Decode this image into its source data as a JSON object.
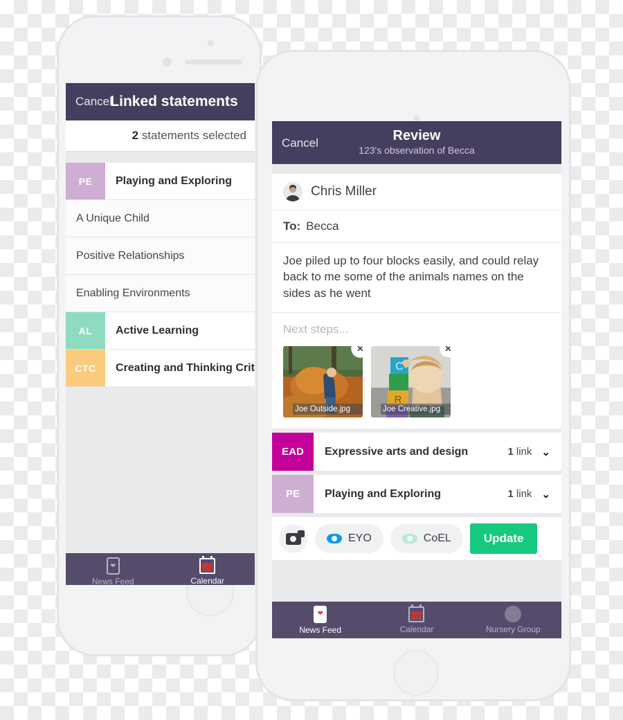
{
  "left_phone": {
    "navbar": {
      "cancel_label": "Cancel",
      "title": "Linked statements"
    },
    "selection_bar": {
      "count": "2",
      "text": " statements selected"
    },
    "statement_groups": [
      {
        "code": "PE",
        "label": "Playing and Exploring",
        "color": "#ceaed2",
        "bold": true
      },
      {
        "code": "",
        "label": "A Unique Child",
        "color": "",
        "bold": false
      },
      {
        "code": "",
        "label": "Positive Relationships",
        "color": "",
        "bold": false
      },
      {
        "code": "",
        "label": "Enabling Environments",
        "color": "",
        "bold": false
      },
      {
        "code": "AL",
        "label": "Active Learning",
        "color": "#8ddcc0",
        "bold": true
      },
      {
        "code": "CTC",
        "label": "Creating and Thinking Critically",
        "color": "#f9cb7c",
        "bold": true
      }
    ],
    "tabbar": [
      {
        "icon": "news-feed-icon",
        "label": "News Feed",
        "active": false
      },
      {
        "icon": "calendar-icon",
        "label": "Calendar",
        "active": true
      }
    ]
  },
  "right_phone": {
    "navbar": {
      "cancel_label": "Cancel",
      "title": "Review",
      "subtitle": "123's observation of Becca"
    },
    "author": {
      "name": "Chris Miller",
      "avatar": "user-avatar"
    },
    "recipient": {
      "label": "To:",
      "value": "Becca"
    },
    "observation_text": "Joe piled up to four blocks easily, and could relay back to me some of the animals names on the sides as he went",
    "next_steps_placeholder": "Next steps...",
    "photos": [
      {
        "caption": "Joe Outside.jpg",
        "remove_icon": "close-icon"
      },
      {
        "caption": "Joe Creative.jpg",
        "remove_icon": "close-icon"
      }
    ],
    "links": [
      {
        "code": "EAD",
        "label": "Expressive arts and design",
        "count": "1",
        "count_unit": " link",
        "color": "#c4009a"
      },
      {
        "code": "PE",
        "label": "Playing and Exploring",
        "count": "1",
        "count_unit": " link",
        "color": "#ceaed2"
      }
    ],
    "actions": {
      "camera_label": "",
      "eyo_label": "EYO",
      "coel_label": "CoEL",
      "update_label": "Update",
      "eyo_color": "#0a9bef",
      "coel_color": "#b6ead4",
      "update_color": "#16c97f"
    },
    "tabbar": [
      {
        "icon": "news-feed-icon",
        "label": "News Feed",
        "active": true
      },
      {
        "icon": "calendar-icon",
        "label": "Calendar",
        "active": false
      },
      {
        "icon": "nursery-group-icon",
        "label": "Nursery Group",
        "active": false
      }
    ]
  },
  "theme": {
    "navbar_color": "#463e5e",
    "tabbar_color": "#554c6b",
    "screen_bg": "#e9eaec"
  }
}
